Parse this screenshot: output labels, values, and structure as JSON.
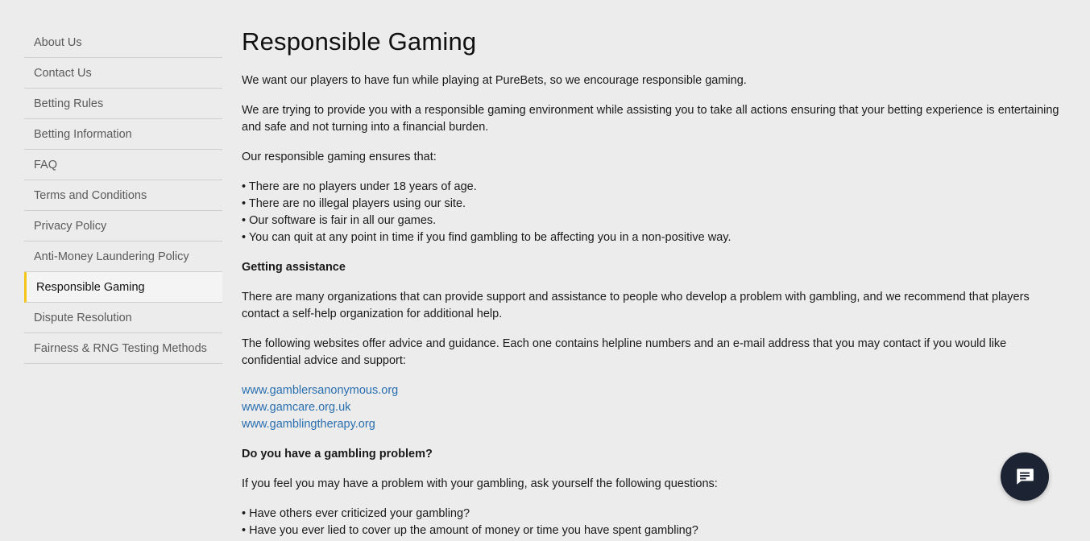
{
  "sidebar": {
    "items": [
      {
        "label": "About Us",
        "active": false
      },
      {
        "label": "Contact Us",
        "active": false
      },
      {
        "label": "Betting Rules",
        "active": false
      },
      {
        "label": "Betting Information",
        "active": false
      },
      {
        "label": "FAQ",
        "active": false
      },
      {
        "label": "Terms and Conditions",
        "active": false
      },
      {
        "label": "Privacy Policy",
        "active": false
      },
      {
        "label": "Anti-Money Laundering Policy",
        "active": false
      },
      {
        "label": "Responsible Gaming",
        "active": true
      },
      {
        "label": "Dispute Resolution",
        "active": false
      },
      {
        "label": "Fairness & RNG Testing Methods",
        "active": false
      }
    ],
    "active_color": "#f5c518"
  },
  "content": {
    "title": "Responsible Gaming",
    "intro": "We want our players to have fun while playing at PureBets, so we encourage responsible gaming.",
    "para2": "We are trying to provide you with a responsible gaming environment while assisting you to take all actions ensuring that your betting experience is entertaining and safe and not turning into a financial burden.",
    "para3": "Our responsible gaming ensures that:",
    "ensures": [
      "• There are no players under 18 years of age.",
      "• There are no illegal players using our site.",
      "• Our software is fair in all our games.",
      "• You can quit at any point in time if you find gambling to be affecting you in a non-positive way."
    ],
    "assist_heading": "Getting assistance",
    "assist_para": "There are many organizations that can provide support and assistance to people who develop a problem with gambling, and we recommend that players contact a self-help organization for additional help.",
    "websites_para": "The following websites offer advice and guidance. Each one contains helpline numbers and an e-mail address that you may contact if you would like confidential advice and support:",
    "links": [
      "www.gamblersanonymous.org",
      "www.gamcare.org.uk",
      "www.gamblingtherapy.org"
    ],
    "problem_heading": "Do you have a gambling problem?",
    "problem_para": "If you feel you may have a problem with your gambling, ask yourself the following questions:",
    "questions": [
      "• Have others ever criticized your gambling?",
      "• Have you ever lied to cover up the amount of money or time you have spent gambling?"
    ],
    "link_color": "#2a6fb0"
  },
  "chat": {
    "icon": "chat-bubble-icon",
    "bg_color": "#1c2433"
  }
}
